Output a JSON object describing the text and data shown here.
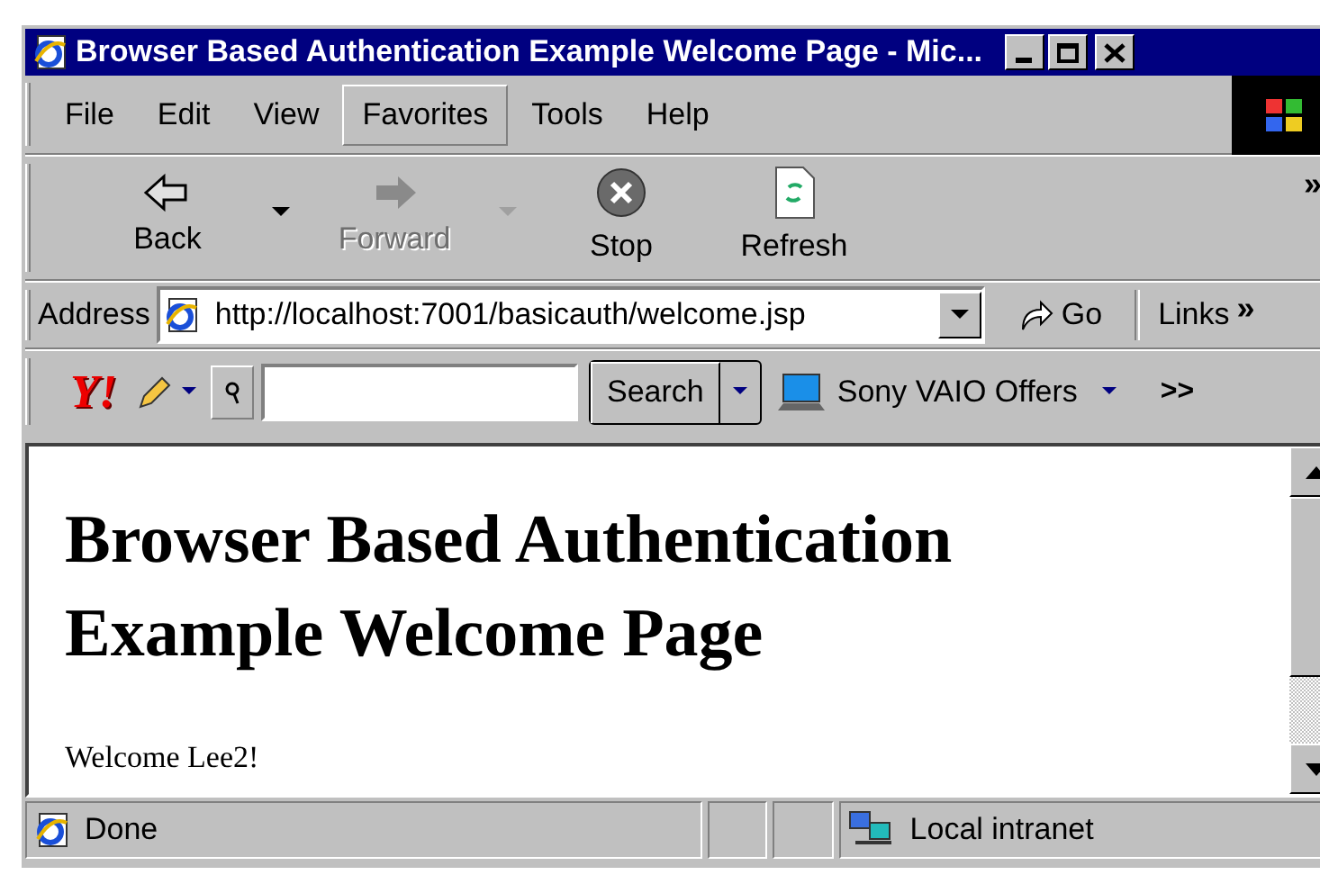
{
  "window": {
    "title": "Browser Based Authentication Example Welcome Page - Mic..."
  },
  "menu": [
    {
      "label": "File",
      "selected": false
    },
    {
      "label": "Edit",
      "selected": false
    },
    {
      "label": "View",
      "selected": false
    },
    {
      "label": "Favorites",
      "selected": true
    },
    {
      "label": "Tools",
      "selected": false
    },
    {
      "label": "Help",
      "selected": false
    }
  ],
  "toolbar": {
    "buttons": [
      {
        "kind": "back",
        "label": "Back",
        "disabled": false,
        "dropdown": true
      },
      {
        "kind": "forward",
        "label": "Forward",
        "disabled": true,
        "dropdown": true
      },
      {
        "kind": "stop",
        "label": "Stop",
        "disabled": false,
        "dropdown": false
      },
      {
        "kind": "refresh",
        "label": "Refresh",
        "disabled": false,
        "dropdown": false
      }
    ],
    "more": "»"
  },
  "address_bar": {
    "label": "Address",
    "value": "http://localhost:7001/basicauth/welcome.jsp",
    "go": "Go",
    "links": "Links",
    "more": "»"
  },
  "search_bar": {
    "logo": "Y!",
    "search": "Search",
    "offers": "Sony VAIO Offers",
    "more": ">>"
  },
  "page": {
    "heading": "Browser Based Authentication Example Welcome Page",
    "text": "Welcome Lee2!"
  },
  "status_bar": {
    "status": "Done",
    "zone": "Local intranet"
  }
}
